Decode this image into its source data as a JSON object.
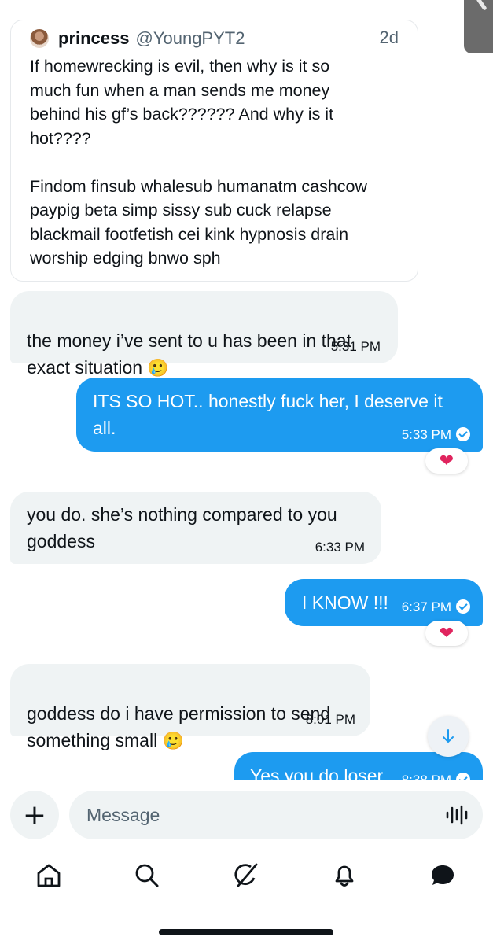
{
  "quote": {
    "name": "princess",
    "handle": "@YoungPYT2",
    "time": "2d",
    "text": "If homewrecking is evil, then why is it so\nmuch fun when a man sends me money\nbehind his gf’s back?????? And why is it\nhot????\n\nFindom finsub whalesub humanatm cashcow\npaypig beta simp sissy sub cuck relapse\nblackmail footfetish cei kink hypnosis drain\nworship edging bnwo sph"
  },
  "messages": [
    {
      "dir": "in",
      "text": "the money i’ve sent to u has been in that\nexact situation",
      "emoji": "🥲",
      "time": "5:31 PM"
    },
    {
      "dir": "out",
      "text": "ITS SO HOT.. honestly fuck her, I deserve it\nall.",
      "time": "5:33 PM",
      "reaction": "❤"
    },
    {
      "dir": "in",
      "text": "you do. she’s nothing compared to you\ngoddess",
      "time": "6:33 PM"
    },
    {
      "dir": "out",
      "text": "I KNOW !!!",
      "time": "6:37 PM",
      "reaction": "❤"
    },
    {
      "dir": "in",
      "text": "goddess do i have permission to send\nsomething small",
      "emoji": "🥲",
      "time": "8:01 PM"
    },
    {
      "dir": "out",
      "text": "Yes you do loser",
      "time": "8:38 PM"
    }
  ],
  "composer": {
    "placeholder": "Message"
  },
  "colors": {
    "accent": "#1d9bf0",
    "incoming_bg": "#eff3f4",
    "reaction": "#e0245e"
  },
  "icons": [
    "plus-icon",
    "voice-wave-icon",
    "home-icon",
    "search-icon",
    "grok-icon",
    "bell-icon",
    "messages-icon",
    "arrow-down-icon"
  ]
}
